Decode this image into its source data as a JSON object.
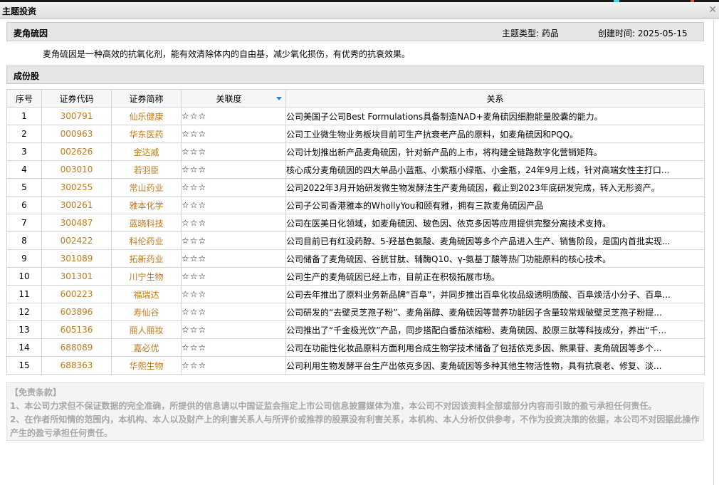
{
  "window": {
    "title": "主题投资"
  },
  "theme": {
    "name": "麦角硫因",
    "type_text": "主题类型: 药品",
    "created_text": "创建时间:  2025-05-15",
    "description": "麦角硫因是一种高效的抗氧化剂，能有效清除体内的自由基，减少氧化损伤，有优秀的抗衰效果。"
  },
  "section_title": "成份股",
  "table": {
    "headers": {
      "no": "序号",
      "code": "证券代码",
      "name": "证券简称",
      "relevance": "关联度",
      "relation": "关系"
    },
    "sort_icon": "sort-desc-icon",
    "rows": [
      {
        "no": "1",
        "code": "300791",
        "name": "仙乐健康",
        "stars": "☆☆☆",
        "relation": "公司美国子公司Best Formulations具备制造NAD+麦角硫因细胞能量胶囊的能力。"
      },
      {
        "no": "2",
        "code": "000963",
        "name": "华东医药",
        "stars": "☆☆☆",
        "relation": "公司工业微生物业务板块目前可生产抗衰老产品的原料，如麦角硫因和PQQ。"
      },
      {
        "no": "3",
        "code": "002626",
        "name": "金达威",
        "stars": "☆☆☆",
        "relation": "公司计划推出新产品麦角硫因，针对新产品的上市，将构建全链路数字化营销矩阵。"
      },
      {
        "no": "4",
        "code": "003010",
        "name": "若羽臣",
        "stars": "☆☆☆",
        "relation": "核心成分麦角硫因的四大单品小蓝瓶、小紫瓶小绿瓶、小金瓶，24年9月上线，针对高端女性主打口..."
      },
      {
        "no": "5",
        "code": "300255",
        "name": "常山药业",
        "stars": "☆☆☆",
        "relation": "公司2022年3月开始研发微生物发酵法生产麦角硫因，截止到2023年底研发完成，转入无形资产。"
      },
      {
        "no": "6",
        "code": "300261",
        "name": "雅本化学",
        "stars": "☆☆☆",
        "relation": "公司子公司香港雅本的WhollyYou和颐有雅，拥有三款麦角硫因产品"
      },
      {
        "no": "7",
        "code": "300487",
        "name": "蓝晓科技",
        "stars": "☆☆☆",
        "relation": "公司在医美日化领域，如麦角硫因、玻色因、依克多因等应用提供完整分离技术支持。"
      },
      {
        "no": "8",
        "code": "002422",
        "name": "科伦药业",
        "stars": "☆☆☆",
        "relation": "公司目前已有红没药醇、5-羟基色氨酸、麦角硫因等多个产品进入生产、销售阶段，是国内首批实现..."
      },
      {
        "no": "9",
        "code": "301089",
        "name": "拓新药业",
        "stars": "☆☆☆",
        "relation": "公司储备了麦角硫因、谷胱甘肽、辅酶Q10、γ-氨基丁酸等热门功能原料的核心技术。"
      },
      {
        "no": "10",
        "code": "301301",
        "name": "川宁生物",
        "stars": "☆☆☆",
        "relation": "公司生产的麦角硫因已经上市，目前正在积极拓展市场。"
      },
      {
        "no": "11",
        "code": "600223",
        "name": "福瑞达",
        "stars": "☆☆☆",
        "relation": "公司去年推出了原料业务新品牌“百阜”，并同步推出百阜化妆品级透明质酸、百阜焕活小分子、百阜..."
      },
      {
        "no": "12",
        "code": "603896",
        "name": "寿仙谷",
        "stars": "☆☆☆",
        "relation": "公司研发的“去壁灵芝孢子粉”、麦角甾醇、麦角硫因等营养功能因子含量较常规破壁灵芝孢子粉提..."
      },
      {
        "no": "13",
        "code": "605136",
        "name": "丽人丽妆",
        "stars": "☆☆☆",
        "relation": "公司推出了“千金极光饮”产品，同步搭配白番茄浓缩粉、麦角硫因、胶原三肽等科技成分，养出“千..."
      },
      {
        "no": "14",
        "code": "688089",
        "name": "嘉必优",
        "stars": "☆☆☆",
        "relation": "公司在功能性化妆品原料方面利用合成生物学技术储备了包括依克多因、熊果苷、麦角硫因等多个..."
      },
      {
        "no": "15",
        "code": "688363",
        "name": "华熙生物",
        "stars": "☆☆☆",
        "relation": "公司利用生物发酵平台生产出依克多因、麦角硫因等多种其他生物活性物，具有抗衰老、修复、淡..."
      }
    ]
  },
  "disclaimer": {
    "title": "【免责条款】",
    "line1": "1、本公司力求但不保证数据的完全准确，所提供的信息请以中国证监会指定上市公司信息披露媒体为准，本公司不对因该资料全部或部分内容而引致的盈亏承担任何责任。",
    "line2": "2、在作者所知情的范围内，本机构、本人以及财产上的利害关系人与所评价或推荐的股票没有利害关系，本机构、本人分析仅供参考，不作为投资决策的依据，本公司不对因据此操作产生的盈亏承担任何责任。"
  }
}
